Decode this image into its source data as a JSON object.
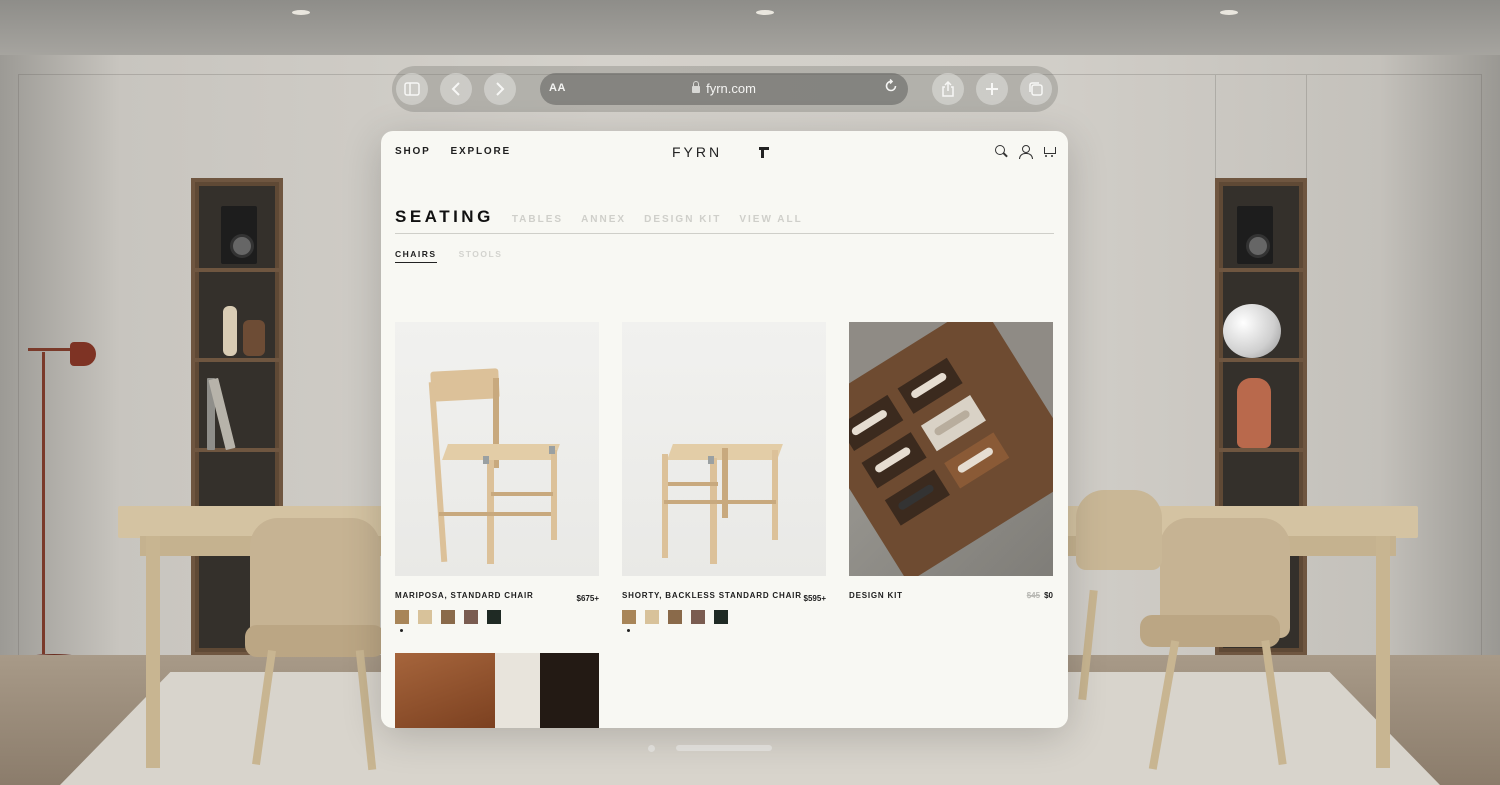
{
  "browser": {
    "url_aa": "AA",
    "url": "fyrn.com",
    "buttons": {
      "sidebar": "sidebar-icon",
      "back": "chevron-left-icon",
      "forward": "chevron-right-icon",
      "reload": "reload-icon",
      "share": "share-icon",
      "new_tab": "plus-icon",
      "tabs": "tabs-icon"
    }
  },
  "site": {
    "nav": {
      "shop": "SHOP",
      "explore": "EXPLORE"
    },
    "brand": "FYRN",
    "categories": {
      "active": "SEATING",
      "items": [
        "TABLES",
        "ANNEX",
        "DESIGN KIT",
        "VIEW ALL"
      ]
    },
    "subcategories": {
      "active": "CHAIRS",
      "other": "STOOLS"
    },
    "products": [
      {
        "name": "MARIPOSA, STANDARD CHAIR",
        "price": "$675+",
        "swatches": [
          "#a88558",
          "#d8c29a",
          "#8a6a4a",
          "#7a5c50",
          "#1f2a24"
        ]
      },
      {
        "name": "SHORTY, BACKLESS STANDARD CHAIR",
        "price": "$595+",
        "swatches": [
          "#a88558",
          "#d8c29a",
          "#8a6a4a",
          "#7a5c50",
          "#1f2a24"
        ]
      },
      {
        "name": "DESIGN KIT",
        "price_old": "$45",
        "price": "$0"
      }
    ]
  },
  "colors": {
    "accent": "#111111",
    "window_bg": "#f8f8f3"
  }
}
